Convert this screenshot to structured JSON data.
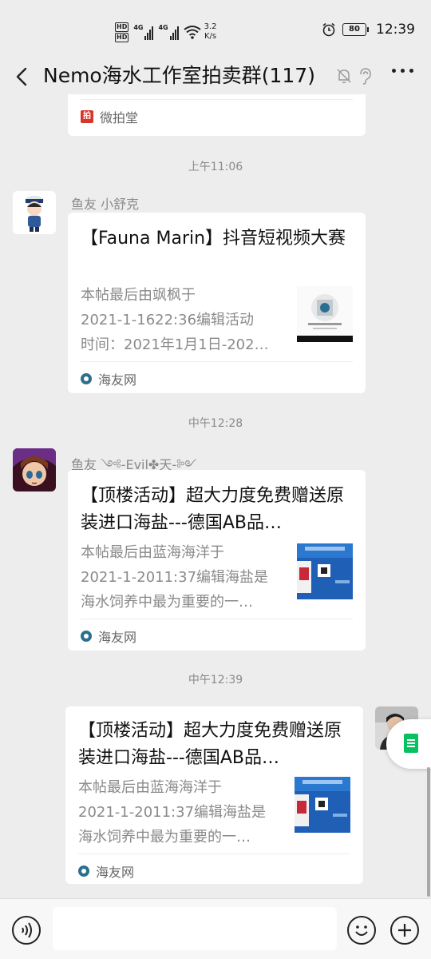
{
  "status_bar": {
    "hd1": "HD",
    "hd2": "HD",
    "sim1": "4G",
    "sim2": "4G",
    "speed_value": "3.2",
    "speed_unit": "K/s",
    "battery": "80",
    "time": "12:39"
  },
  "nav": {
    "title": "Nemo海水工作室拍卖群(117)"
  },
  "messages": [
    {
      "source": "微拍堂",
      "source_icon": "weipaitang-logo"
    },
    {
      "time": "上午11:06",
      "sender": "鱼友 小舒克",
      "title": "【Fauna Marin】抖音短视频大赛",
      "desc": [
        "本帖最后由飒枫于",
        "2021-1-1622:36编辑活动",
        "时间：2021年1月1日-202…"
      ],
      "source": "海友网"
    },
    {
      "time": "中午12:28",
      "sender": "鱼友 ༺-Evil✤天-༻",
      "title": "【顶楼活动】超大力度免费赠送原装进口海盐---德国AB品…",
      "desc": [
        "本帖最后由蓝海海洋于",
        "2021-1-2011:37编辑海盐是",
        "海水饲养中最为重要的一…"
      ],
      "source": "海友网"
    },
    {
      "time": "中午12:39",
      "title": "【顶楼活动】超大力度免费赠送原装进口海盐---德国AB品…",
      "desc": [
        "本帖最后由蓝海海洋于",
        "2021-1-2011:37编辑海盐是",
        "海水饲养中最为重要的一…"
      ],
      "source": "海友网"
    }
  ],
  "input_bar": {
    "text_value": "",
    "placeholder": ""
  },
  "colors": {
    "background": "#ededed",
    "card": "#ffffff",
    "timestamp": "#8a8a8a",
    "accent_green": "#07c160",
    "source_icon": "#2b6f8f"
  },
  "icons": [
    "back-arrow-icon",
    "mute-bell-icon",
    "earpiece-icon",
    "more-dots-icon",
    "voice-icon",
    "emoji-icon",
    "plus-icon",
    "document-icon",
    "alarm-icon",
    "wifi-icon",
    "battery-icon"
  ]
}
